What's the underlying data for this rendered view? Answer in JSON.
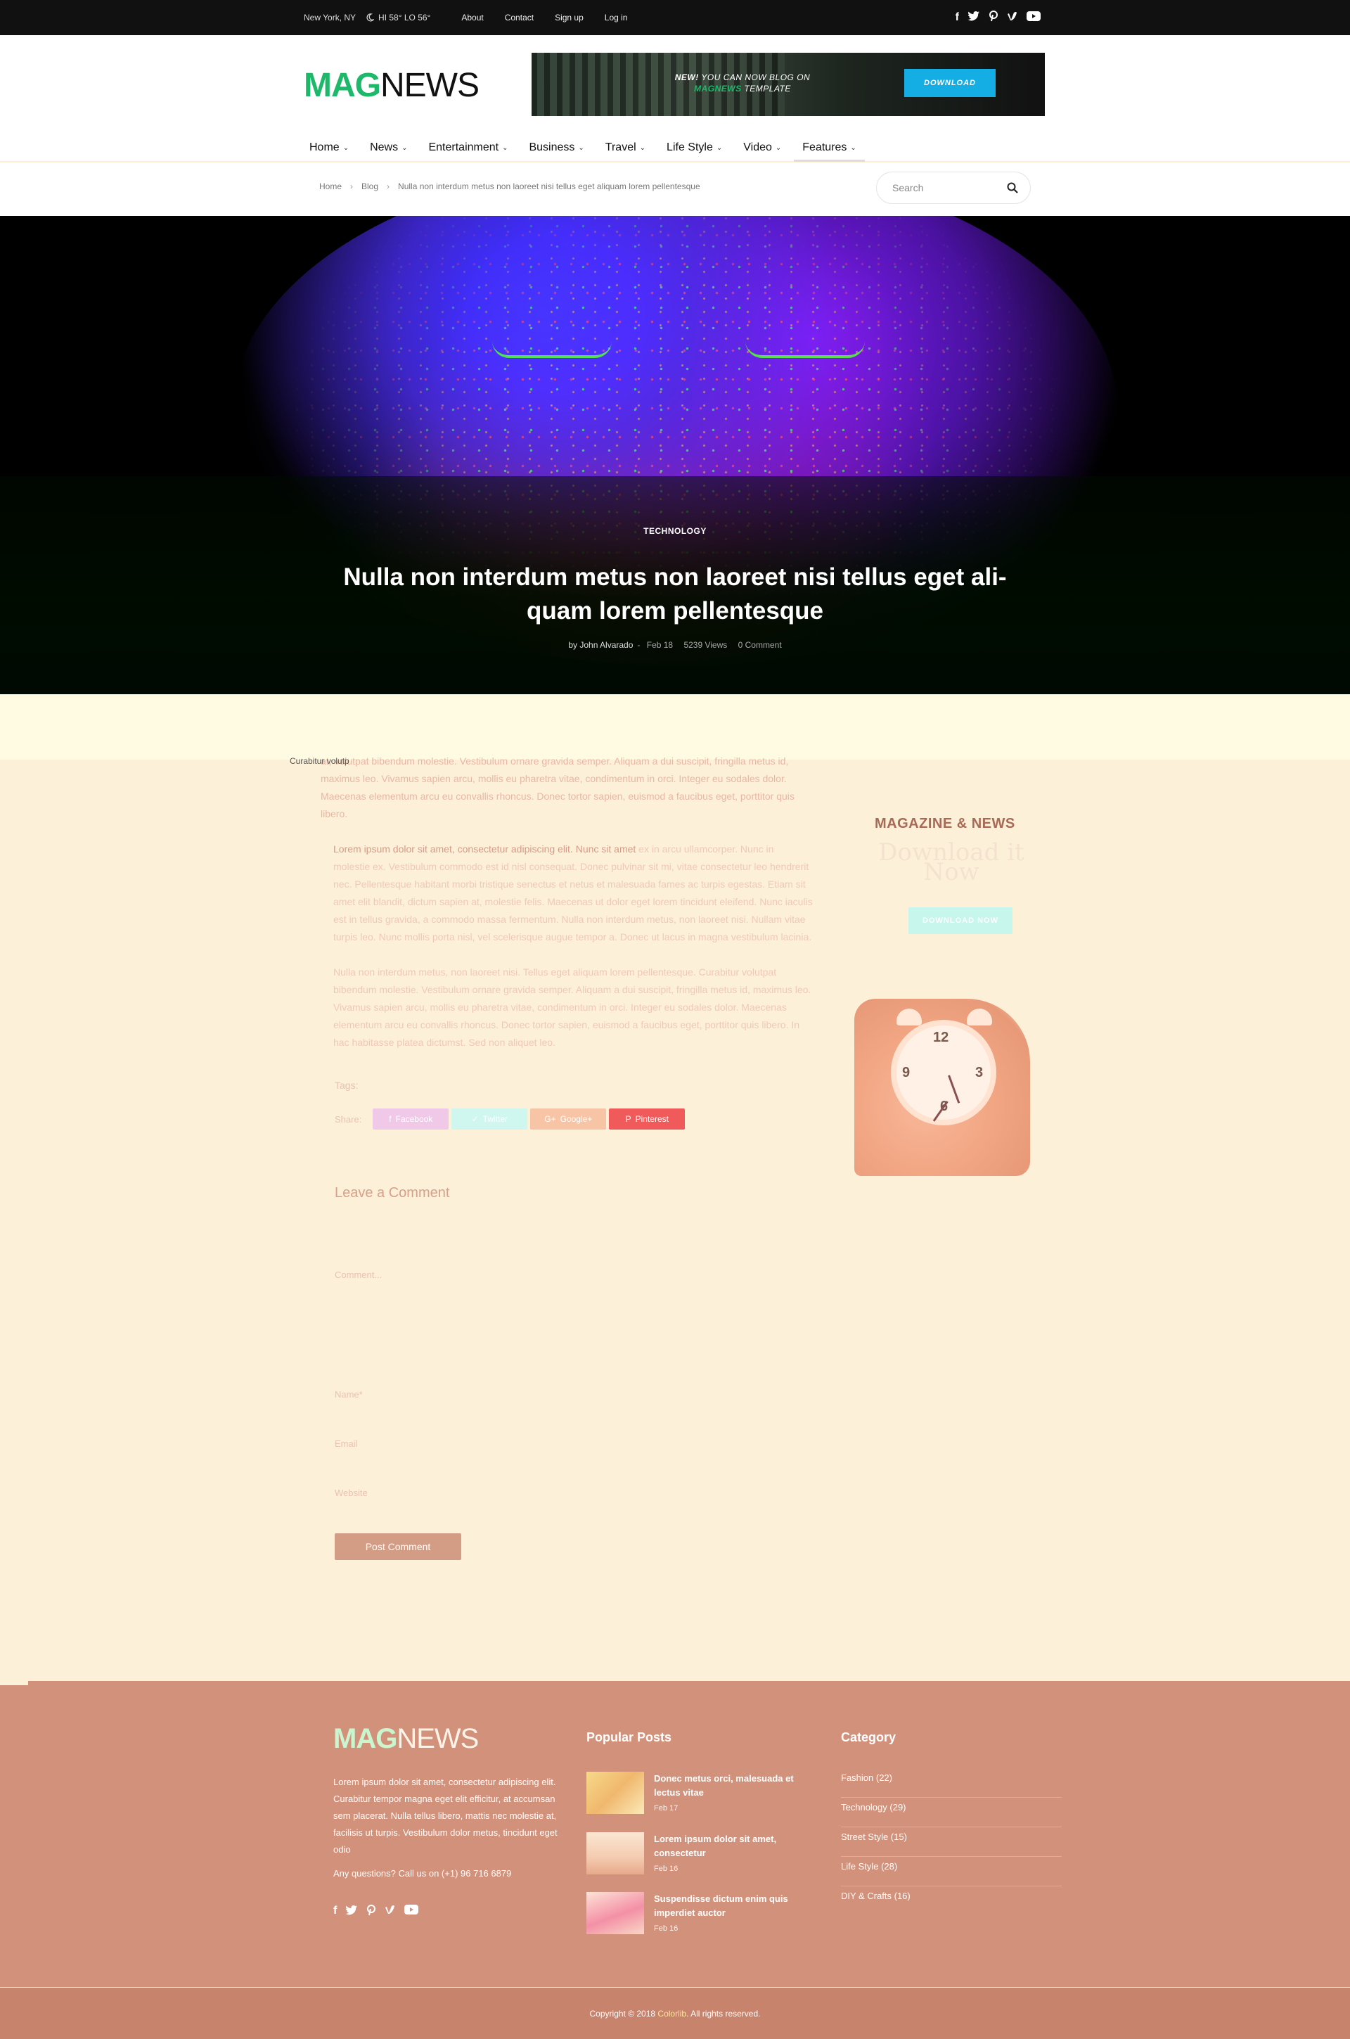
{
  "topbar": {
    "location": "New York, NY",
    "weather": "HI 58° LO 56°",
    "links": [
      "About",
      "Contact",
      "Sign up",
      "Log in"
    ],
    "social_icons": [
      "facebook-icon",
      "twitter-icon",
      "pinterest-icon",
      "vimeo-icon",
      "youtube-icon"
    ]
  },
  "header": {
    "logo_mag": "MAG",
    "logo_news": "NEWS",
    "banner": {
      "new": "NEW!",
      "text1": "YOU CAN NOW BLOG ON",
      "brand": "MAGNEWS",
      "text2": "TEMPLATE",
      "button": "DOWNLOAD"
    },
    "nav": [
      "Home",
      "News",
      "Entertainment",
      "Business",
      "Travel",
      "Life Style",
      "Video",
      "Features"
    ]
  },
  "breadcrumb": {
    "items": [
      "Home",
      "Blog",
      "Nulla non interdum metus non laoreet nisi tellus eget aliquam lorem pellentesque"
    ],
    "search_placeholder": "Search"
  },
  "hero": {
    "category": "TECHNOLOGY",
    "title_line1": "Nulla non interdum metus non laoreet nisi tellus eget ali-",
    "title_line2": "quam lorem pellentesque",
    "author": "by John Alvarado",
    "date": "Feb 18",
    "views": "5239 Views",
    "comments": "0 Comment"
  },
  "article": {
    "dropcap": "Curabitur volutp",
    "p1": "at, volutpat bibendum molestie. Vestibulum ornare gravida semper. Aliquam a dui suscipit, fringilla metus id, maximus leo. Vivamus sapien arcu, mollis eu pharetra vitae, condimentum in orci. Integer eu sodales dolor. Maecenas elementum arcu eu convallis rhoncus. Donec tortor sapien, euismod a faucibus eget, porttitor quis libero.",
    "p2_lead": "Lorem ipsum dolor sit amet, consectetur adipiscing elit. Nunc sit amet",
    "p2": " ex in arcu ullamcorper. Nunc in molestie ex. Vestibulum commodo est id nisl consequat. Donec pulvinar sit mi, vitae consectetur leo hendrerit nec. Pellentesque habitant morbi tristique senectus et netus et malesuada fames ac turpis egestas. Etiam sit amet elit blandit, dictum sapien at, molestie felis. Maecenas ut dolor eget lorem tincidunt eleifend. Nunc iaculis est in tellus gravida, a commodo massa fermentum. Nulla non interdum metus, non laoreet nisi. Nullam vitae turpis leo. Nunc mollis porta nisl, vel scelerisque augue tempor a. Donec ut lacus in magna vestibulum lacinia.",
    "p3": "Nulla non interdum metus, non laoreet nisi. Tellus eget aliquam lorem pellentesque. Curabitur volutpat bibendum molestie. Vestibulum ornare gravida semper. Aliquam a dui suscipit, fringilla metus id, maximus leo. Vivamus sapien arcu, mollis eu pharetra vitae, condimentum in orci. Integer eu sodales dolor. Maecenas elementum arcu eu convallis rhoncus. Donec tortor sapien, euismod a faucibus eget, porttitor quis libero. In hac habitasse platea dictumst. Sed non aliquet leo.",
    "tags_label": "Tags:",
    "share_label": "Share:",
    "share": {
      "facebook": "Facebook",
      "twitter": "Twitter",
      "google": "Google+",
      "pinterest": "Pinterest"
    }
  },
  "comment_form": {
    "heading": "Leave a Comment",
    "comment_ph": "Comment...",
    "name_ph": "Name*",
    "email_ph": "Email",
    "website_ph": "Website",
    "submit": "Post Comment"
  },
  "sidebar_ad": {
    "title": "MAGAZINE & NEWS",
    "subtitle": "Download it Now",
    "button": "DOWNLOAD NOW",
    "clock_numbers": [
      "12",
      "3",
      "6",
      "9"
    ]
  },
  "footer": {
    "logo_mag": "MAG",
    "logo_news": "NEWS",
    "about": "Lorem ipsum dolor sit amet, consectetur adipiscing elit. Curabitur tempor magna eget elit efficitur, at accumsan sem placerat. Nulla tellus libero, mattis nec molestie at, facilisis ut turpis. Vestibulum dolor metus, tincidunt eget odio",
    "call": "Any questions? Call us on (+1) 96 716 6879",
    "social_icons": [
      "facebook-icon",
      "twitter-icon",
      "pinterest-icon",
      "vimeo-icon",
      "youtube-icon"
    ],
    "popular_heading": "Popular Posts",
    "popular": [
      {
        "title": "Donec metus orci, malesuada et lectus vitae",
        "date": "Feb 17"
      },
      {
        "title": "Lorem ipsum dolor sit amet, consectetur",
        "date": "Feb 16"
      },
      {
        "title": "Suspendisse dictum enim quis imperdiet auctor",
        "date": "Feb 16"
      }
    ],
    "category_heading": "Category",
    "categories": [
      "Fashion (22)",
      "Technology (29)",
      "Street Style (15)",
      "Life Style (28)",
      "DIY & Crafts (16)"
    ],
    "copyright_pre": "Copyright © 2018 ",
    "copyright_brand": "Colorlib",
    "copyright_post": ". All rights reserved."
  },
  "colors": {
    "brand_green": "#1db86a",
    "footer_bg": "#d2917a",
    "content_bg": "#fdf0d8",
    "download_blue": "#14aee4"
  }
}
